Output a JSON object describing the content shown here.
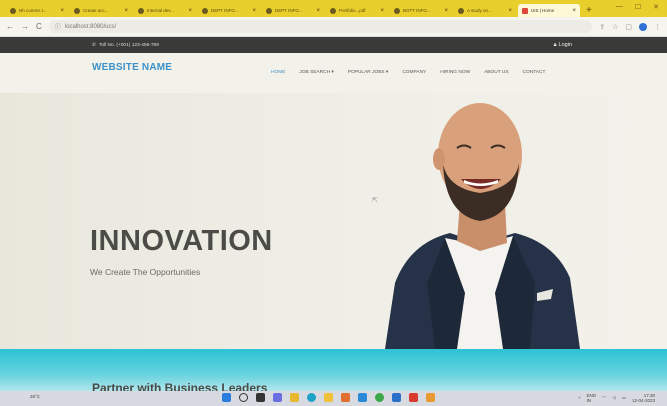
{
  "browser": {
    "tabs": [
      {
        "title": "Nh comms t..."
      },
      {
        "title": "Create acc..."
      },
      {
        "title": "Internal dev..."
      },
      {
        "title": "DEPT INFO..."
      },
      {
        "title": "DEPT INFO..."
      },
      {
        "title": "Portfolio...pdf"
      },
      {
        "title": "BOTT INFO..."
      },
      {
        "title": "A study on..."
      },
      {
        "title": "UIS | Home"
      }
    ],
    "new_tab_label": "+",
    "url": "localhost:8080/ucs/"
  },
  "topbar": {
    "phone": "Toll No. (+001) 123-456-789",
    "login": "Login"
  },
  "header": {
    "logo": "WEBSITE NAME",
    "nav": [
      {
        "label": "HOME",
        "active": true
      },
      {
        "label": "JOB SEARCH ▾",
        "active": false
      },
      {
        "label": "POPULAR JOBS ▾",
        "active": false
      },
      {
        "label": "COMPANY",
        "active": false
      },
      {
        "label": "HIRING NOW",
        "active": false
      },
      {
        "label": "ABOUT US",
        "active": false
      },
      {
        "label": "CONTACT",
        "active": false
      }
    ]
  },
  "hero": {
    "title": "INNOVATION",
    "subtitle": "We Create The Opportunities"
  },
  "section": {
    "title": "Partner with Business Leaders"
  },
  "taskbar": {
    "weather": "26°C",
    "tray_lang": "ENG",
    "tray_region": "IN",
    "time": "17:30",
    "date": "12-04-2023"
  },
  "colors": {
    "accent": "#3c92c8",
    "chrome_tabbar": "#e9cf2c",
    "topbar": "#3a3a38",
    "teal_band": "#2cc2d4"
  }
}
